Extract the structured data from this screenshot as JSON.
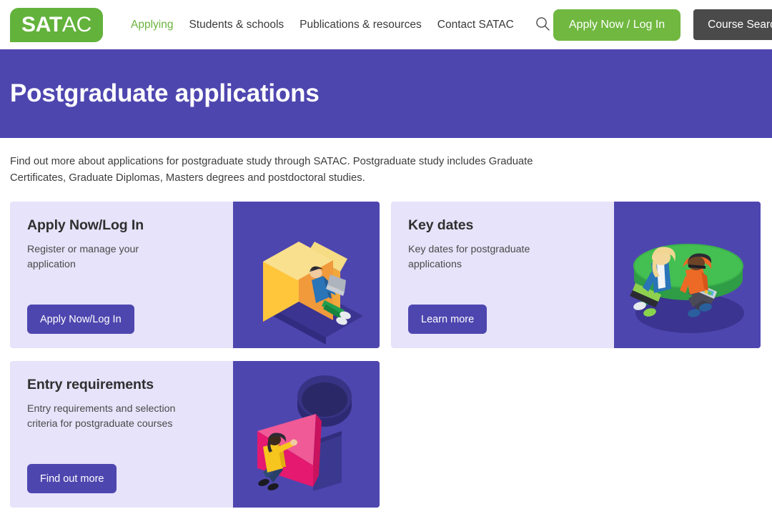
{
  "header": {
    "logo": {
      "text_bold": "SAT",
      "text_light": "AC",
      "color": "#63b23c"
    },
    "nav": [
      {
        "label": "Applying",
        "active": true
      },
      {
        "label": "Students & schools",
        "active": false
      },
      {
        "label": "Publications & resources",
        "active": false
      },
      {
        "label": "Contact SATAC",
        "active": false
      }
    ],
    "search_icon": "search-icon",
    "apply_button": {
      "label": "Apply Now / Log In",
      "color": "#70b840"
    },
    "course_search_button": {
      "label": "Course Search",
      "color": "#4a4a4a"
    }
  },
  "hero": {
    "title": "Postgraduate applications",
    "background": "#4e46af"
  },
  "intro": {
    "text": "Find out more about applications for postgraduate study through SATAC. Postgraduate study includes Graduate Certificates, Graduate Diplomas, Masters degrees and postdoctoral studies."
  },
  "cards": [
    {
      "title": "Apply Now/Log In",
      "description": "Register or manage your application",
      "button_label": "Apply Now/Log In",
      "art": "illustration-person-laptop-yellow-block",
      "art_background": "#4e46af",
      "card_background": "#e6e3fa"
    },
    {
      "title": "Key dates",
      "description": "Key dates for postgraduate applications",
      "button_label": "Learn more",
      "art": "illustration-two-people-green-circle",
      "art_background": "#4e46af",
      "card_background": "#e6e3fa"
    },
    {
      "title": "Entry requirements",
      "description": "Entry requirements and selection criteria for postgraduate courses",
      "button_label": "Find out more",
      "art": "illustration-person-pink-triangle",
      "art_background": "#4e46af",
      "card_background": "#e6e3fa"
    }
  ]
}
